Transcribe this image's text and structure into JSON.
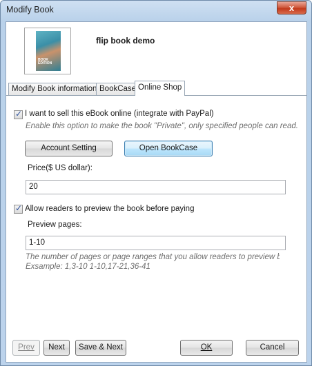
{
  "window": {
    "title": "Modify Book",
    "close_glyph": "x"
  },
  "book": {
    "title": "flip book demo",
    "cover_text_line1": "BOOK",
    "cover_text_line2": "EDITION"
  },
  "tabs": [
    {
      "label": "Modify Book information",
      "active": false
    },
    {
      "label": "BookCase",
      "active": false
    },
    {
      "label": "Online Shop",
      "active": true
    }
  ],
  "online_shop": {
    "sell_checkbox_label": "I want to sell this eBook online (integrate with PayPal)",
    "sell_checked": true,
    "sell_hint": "Enable this option to make the book \"Private\", only specified people can read.",
    "account_setting_button": "Account Setting",
    "open_bookcase_button": "Open BookCase",
    "price_label": "Price($ US dollar):",
    "price_value": "20",
    "preview_checkbox_label": "Allow readers to preview the book before paying",
    "preview_checked": true,
    "preview_pages_label": "Preview pages:",
    "preview_pages_value": "1-10",
    "preview_hint_line1": "The number of pages or page ranges that you allow readers to preview befo",
    "preview_hint_line2": "Exsample: 1,3-10   1-10,17-21,36-41"
  },
  "footer": {
    "prev": "Prev",
    "next": "Next",
    "save_next": "Save & Next",
    "ok": "OK",
    "cancel": "Cancel"
  }
}
